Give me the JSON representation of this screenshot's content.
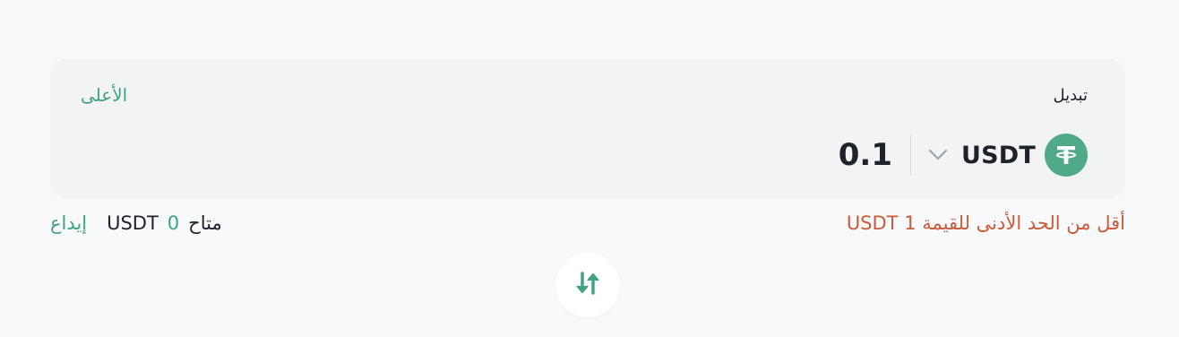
{
  "from": {
    "label": "تبديل",
    "max_label": "الأعلى",
    "amount": "0.1",
    "token": {
      "symbol": "USDT",
      "icon": "tether-icon"
    }
  },
  "validation": {
    "error": "أقل من الحد الأدنى للقيمة 1 USDT"
  },
  "balance": {
    "label": "متاح",
    "value": "0",
    "unit": "USDT",
    "deposit_label": "إيداع"
  },
  "swap_button": {
    "icon": "swap-arrows-icon"
  },
  "colors": {
    "accent": "#3fa37f",
    "error": "#c85c3d",
    "text": "#1f2329",
    "card": "#f2f3f5",
    "background": "#f8f9fb"
  }
}
